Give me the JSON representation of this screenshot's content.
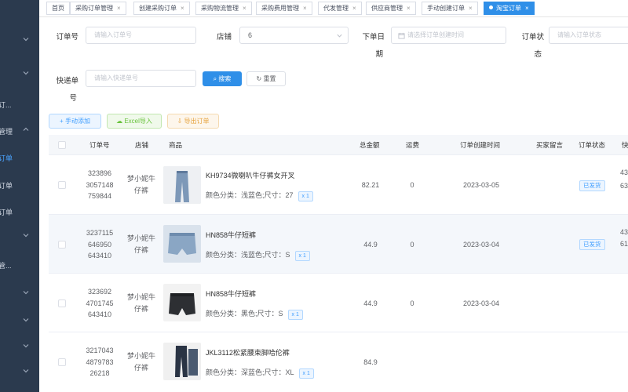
{
  "sidebar": {
    "items": [
      {
        "label": "订..."
      },
      {
        "label": "管理"
      },
      {
        "label": "订单"
      },
      {
        "label": "订单"
      },
      {
        "label": "订单"
      },
      {
        "label": "管..."
      }
    ]
  },
  "tabs": [
    {
      "label": "首页",
      "closable": false
    },
    {
      "label": "采购订单管理",
      "closable": true
    },
    {
      "label": "创建采购订单",
      "closable": true
    },
    {
      "label": "采购物流管理",
      "closable": true
    },
    {
      "label": "采购费用管理",
      "closable": true
    },
    {
      "label": "代发管理",
      "closable": true
    },
    {
      "label": "供应商管理",
      "closable": true
    },
    {
      "label": "手动创建订单",
      "closable": true
    },
    {
      "label": "淘宝订单",
      "closable": true,
      "active": true
    }
  ],
  "search": {
    "order_no_label": "订单号",
    "order_no_placeholder": "请输入订单号",
    "shop_label": "店铺",
    "shop_value": "6",
    "order_date_label_1": "下单日",
    "order_date_label_2": "期",
    "order_date_placeholder": "请选择订单创建时间",
    "status_label_1": "订单状",
    "status_label_2": "态",
    "status_placeholder": "请输入订单状态",
    "tracking_label_1": "快递单",
    "tracking_label_2": "号",
    "tracking_placeholder": "请输入快递单号",
    "search_button": "搜索",
    "reset_button": "重置"
  },
  "toolbar": {
    "manual_add": "手动添加",
    "excel_import": "Excel导入",
    "export_orders": "导出订单"
  },
  "table": {
    "headers": [
      "订单号",
      "店铺",
      "商品",
      "总金额",
      "运费",
      "订单创建时间",
      "买家留言",
      "订单状态",
      "快"
    ],
    "rows": [
      {
        "order_no": [
          "323896",
          "3057148",
          "759844"
        ],
        "shop": [
          "梦小妮牛",
          "仔裤"
        ],
        "product_name": "KH9734微喇叭牛仔裤女开叉",
        "product_attr": "颜色分类：浅蓝色;尺寸：27",
        "qty": "x 1",
        "total": "82.21",
        "freight": "0",
        "created": "2023-03-05",
        "status": "已发货",
        "cut_1": "43",
        "cut_2": "63"
      },
      {
        "order_no": [
          "3237115",
          "646950",
          "643410"
        ],
        "shop": [
          "梦小妮牛",
          "仔裤"
        ],
        "product_name": "HN858牛仔短裤",
        "product_attr": "颜色分类：浅蓝色;尺寸：S",
        "qty": "x 1",
        "total": "44.9",
        "freight": "0",
        "created": "2023-03-04",
        "status": "已发货",
        "cut_1": "43",
        "cut_2": "61"
      },
      {
        "order_no": [
          "323692",
          "4701745",
          "643410"
        ],
        "shop": [
          "梦小妮牛",
          "仔裤"
        ],
        "product_name": "HN858牛仔短裤",
        "product_attr": "颜色分类：黑色;尺寸：S",
        "qty": "x 1",
        "total": "44.9",
        "freight": "0",
        "created": "2023-03-04",
        "status": "",
        "cut_1": "",
        "cut_2": ""
      },
      {
        "order_no": [
          "3217043",
          "4879783",
          "26218"
        ],
        "shop": [
          "梦小妮牛",
          "仔裤"
        ],
        "product_name": "JKL3112松紧腰束脚哈伦裤",
        "product_attr": "颜色分类：深蓝色;尺寸：XL",
        "qty": "x 1",
        "total": "84.9",
        "freight": "",
        "created": "",
        "status": "",
        "cut_1": "",
        "cut_2": ""
      }
    ]
  },
  "colors": {
    "sidebar_bg": "#2b3a4e",
    "accent": "#2f8fe8",
    "status_tag": "#409eff"
  },
  "icons": {
    "search_button_icon": "search-icon",
    "reset_button_icon": "refresh-icon",
    "manual_add_icon": "plus-icon",
    "excel_import_icon": "upload-icon",
    "export_icon": "download-icon",
    "date_icon": "calendar-icon",
    "select_caret": "chevron-down-icon"
  }
}
